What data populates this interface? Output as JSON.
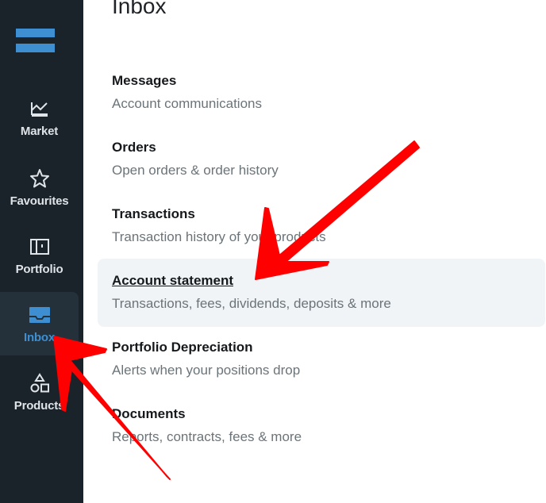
{
  "sidebar": {
    "items": [
      {
        "id": "market",
        "label": "Market",
        "icon": "chart-icon"
      },
      {
        "id": "favourites",
        "label": "Favourites",
        "icon": "star-icon"
      },
      {
        "id": "portfolio",
        "label": "Portfolio",
        "icon": "portfolio-icon"
      },
      {
        "id": "inbox",
        "label": "Inbox",
        "icon": "inbox-icon",
        "active": true
      },
      {
        "id": "products",
        "label": "Products",
        "icon": "shapes-icon"
      }
    ]
  },
  "main": {
    "title": "Inbox",
    "entries": [
      {
        "title": "Messages",
        "subtitle": "Account communications"
      },
      {
        "title": "Orders",
        "subtitle": "Open orders & order history"
      },
      {
        "title": "Transactions",
        "subtitle": "Transaction history of your products"
      },
      {
        "title": "Account statement",
        "subtitle": "Transactions, fees, dividends, deposits & more",
        "highlighted": true
      },
      {
        "title": "Portfolio Depreciation",
        "subtitle": "Alerts when your positions drop"
      },
      {
        "title": "Documents",
        "subtitle": "Reports, contracts, fees & more"
      }
    ]
  },
  "colors": {
    "sidebar_bg": "#1b232a",
    "accent": "#3d8fd1",
    "annotation_arrow": "#ff0000",
    "highlight_bg": "#f1f4f7"
  }
}
